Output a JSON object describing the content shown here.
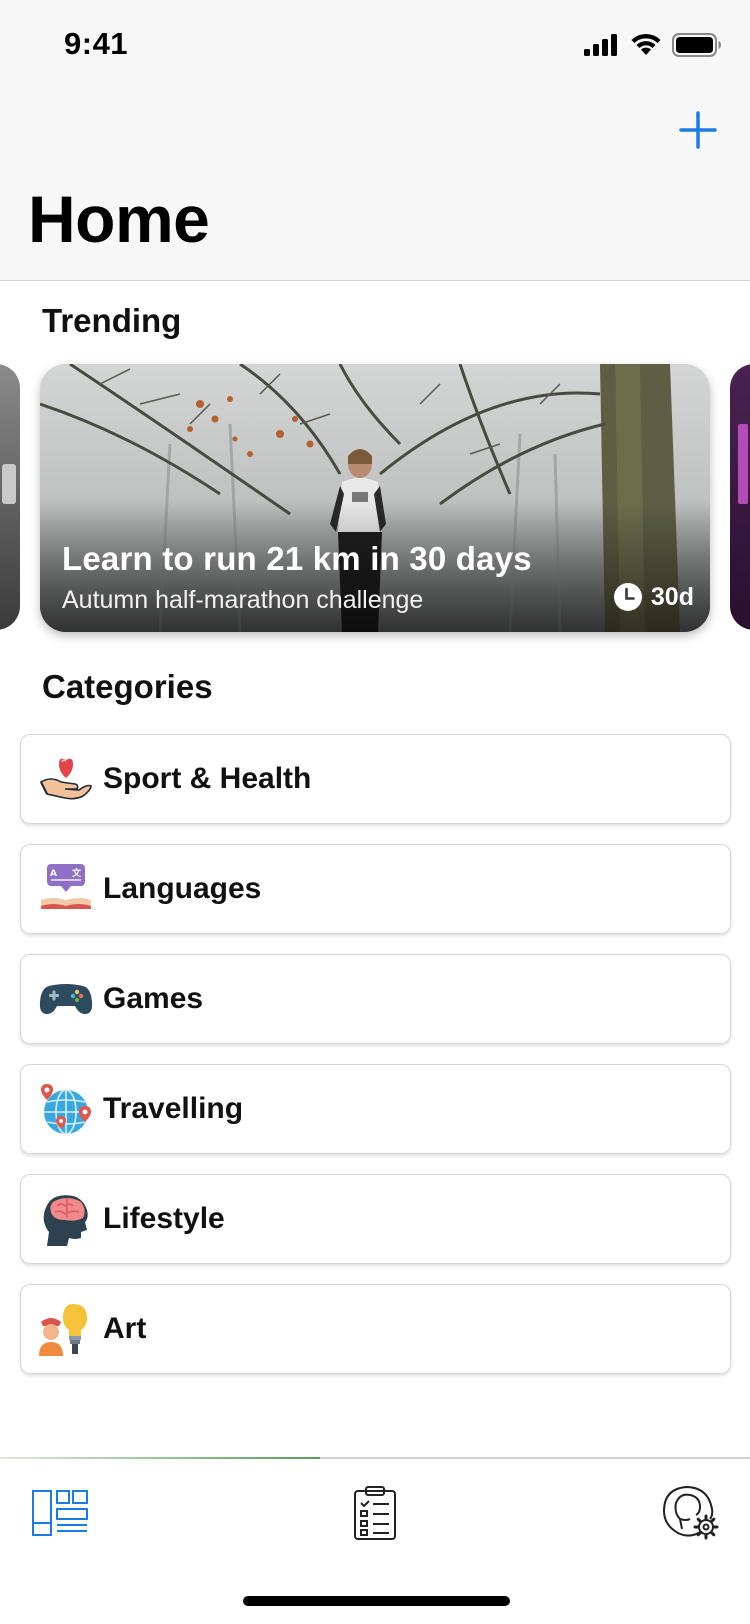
{
  "status_bar": {
    "time": "9:41"
  },
  "header": {
    "title": "Home"
  },
  "trending": {
    "section_title": "Trending",
    "card": {
      "title": "Learn to run 21 km in 30 days",
      "subtitle": "Autumn half-marathon challenge",
      "duration": "30d"
    }
  },
  "categories": {
    "section_title": "Categories",
    "items": [
      {
        "label": "Sport & Health",
        "icon": "heart-hand-icon"
      },
      {
        "label": "Languages",
        "icon": "translate-book-icon"
      },
      {
        "label": "Games",
        "icon": "gamepad-icon"
      },
      {
        "label": "Travelling",
        "icon": "globe-pins-icon"
      },
      {
        "label": "Lifestyle",
        "icon": "head-brain-icon"
      },
      {
        "label": "Art",
        "icon": "artist-bulb-icon"
      }
    ]
  },
  "tab_bar": {
    "tabs": [
      {
        "icon": "dashboard-icon",
        "active": true
      },
      {
        "icon": "checklist-icon",
        "active": false
      },
      {
        "icon": "profile-settings-icon",
        "active": false
      }
    ]
  },
  "colors": {
    "accent": "#1a7ce6",
    "header_bg": "#f7f7f7",
    "text": "#111111"
  }
}
